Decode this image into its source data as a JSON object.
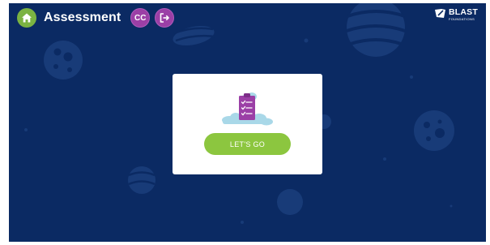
{
  "header": {
    "home_icon": "home-icon",
    "title": "Assessment",
    "user_initials": "CC",
    "logout_icon": "logout-icon"
  },
  "brand": {
    "name": "BLAST",
    "sub": "FOUNDATIONS",
    "logo_icon": "blast-logo-icon"
  },
  "card": {
    "illustration": "clipboard-checklist-icon",
    "cta_label": "LET'S GO"
  },
  "colors": {
    "background": "#0b2a63",
    "home_button": "#7bb342",
    "avatar": "#9b3fa6",
    "cta": "#8cc63f",
    "clipboard": "#9b3fa6",
    "cloud": "#a9d8e8"
  }
}
